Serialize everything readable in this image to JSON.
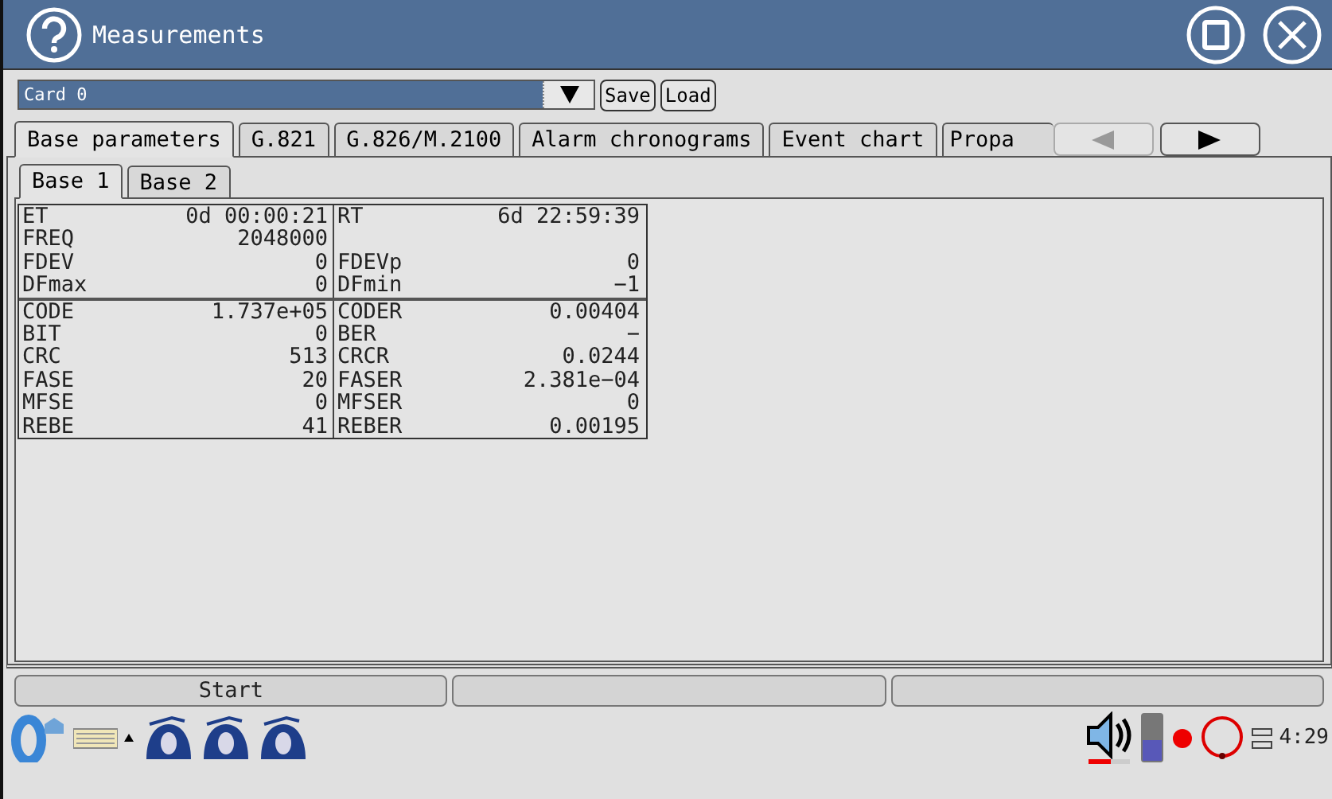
{
  "window": {
    "title": "Measurements"
  },
  "card_selector": {
    "value": "Card 0"
  },
  "toolbar_buttons": [
    "Save",
    "Load"
  ],
  "tabs": [
    {
      "label": "Base parameters",
      "selected": true
    },
    {
      "label": "G.821",
      "selected": false
    },
    {
      "label": "G.826/M.2100",
      "selected": false
    },
    {
      "label": "Alarm chronograms",
      "selected": false
    },
    {
      "label": "Event chart",
      "selected": false
    },
    {
      "label": "Propa",
      "selected": false
    }
  ],
  "tab_scroll": [
    {
      "kind": "left",
      "disabled": true
    },
    {
      "kind": "right",
      "disabled": false
    }
  ],
  "subtabs": [
    {
      "label": "Base 1",
      "selected": true
    },
    {
      "label": "Base 2",
      "selected": false
    }
  ],
  "table": {
    "groups": [
      {
        "rows": [
          {
            "left_label": "ET",
            "left_value": "0d 00:00:21",
            "right_label": "RT",
            "right_value": "6d 22:59:39"
          },
          {
            "left_label": "FREQ",
            "left_value": "2048000"
          },
          {
            "left_label": "FDEV",
            "left_value": "0",
            "right_label": "FDEVp",
            "right_value": "0"
          },
          {
            "left_label": "DFmax",
            "left_value": "0",
            "right_label": "DFmin",
            "right_value": "−1"
          }
        ]
      },
      {
        "rows": [
          {
            "left_label": "CODE",
            "left_value": "1.737e+05",
            "right_label": "CODER",
            "right_value": "0.00404"
          },
          {
            "left_label": "BIT",
            "left_value": "0",
            "right_label": "BER",
            "right_value": "−"
          },
          {
            "left_label": "CRC",
            "left_value": "513",
            "right_label": "CRCR",
            "right_value": "0.0244"
          },
          {
            "left_label": "FASE",
            "left_value": "20",
            "right_label": "FASER",
            "right_value": "2.381e−04"
          },
          {
            "left_label": "MFSE",
            "left_value": "0",
            "right_label": "MFSER",
            "right_value": "0"
          },
          {
            "left_label": "REBE",
            "left_value": "41",
            "right_label": "REBER",
            "right_value": "0.00195"
          }
        ]
      }
    ]
  },
  "bottom_bar": {
    "buttons": [
      "Start"
    ]
  },
  "taskbar": {
    "clock": "4:29"
  }
}
